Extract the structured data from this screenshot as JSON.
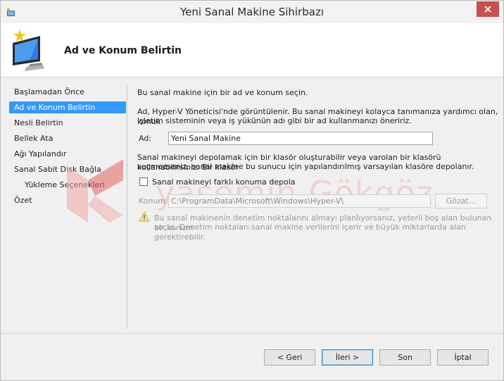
{
  "window": {
    "title": "Yeni Sanal Makine Sihirbazı"
  },
  "header": {
    "page_title": "Ad ve Konum Belirtin"
  },
  "nav": {
    "items": [
      {
        "label": "Başlamadan Önce",
        "active": false,
        "sub": false
      },
      {
        "label": "Ad ve Konum Belirtin",
        "active": true,
        "sub": false
      },
      {
        "label": "Nesli Belirtin",
        "active": false,
        "sub": false
      },
      {
        "label": "Bellek Ata",
        "active": false,
        "sub": false
      },
      {
        "label": "Ağı Yapılandır",
        "active": false,
        "sub": false
      },
      {
        "label": "Sanal Sabit Disk Bağla",
        "active": false,
        "sub": false
      },
      {
        "label": "Yükleme Seçenekleri",
        "active": false,
        "sub": true
      },
      {
        "label": "Özet",
        "active": false,
        "sub": false
      }
    ]
  },
  "content": {
    "intro": "Bu sanal makine için bir ad ve konum seçin.",
    "desc_line1": "Ad, Hyper-V Yöneticisi'nde görüntülenir. Bu sanal makineyi kolayca tanımanıza yardımcı olan, konuk",
    "desc_line2": "işletim sisteminin veya iş yükünün adı gibi bir ad kullanmanızı öneririz.",
    "name_label": "Ad:",
    "name_value": "Yeni Sanal Makine",
    "store_line1": "Sanal makineyi depolamak için bir klasör oluşturabilir veya varolan bir klasörü kullanabilirsiniz. Bir klasör",
    "store_line2": "seçmezseniz, sanal makine bu sunucu için yapılandırılmış varsayılan klasöre depolanır.",
    "checkbox_label": "Sanal makineyi farklı konuma depola",
    "location_label": "Konum:",
    "location_value": "C:\\ProgramData\\Microsoft\\Windows\\Hyper-V\\",
    "browse_label": "Gözat...",
    "warn_line1": "Bu sanal makinenin denetim noktalarını almayı planlıyorsanız, yeterli boş alan bulunan bir konum",
    "warn_line2": "seçin. Denetim noktaları sanal makine verilerini içerir ve büyük miktarlarda alan gerektirebilir."
  },
  "buttons": {
    "back": "< Geri",
    "next": "İleri >",
    "finish": "Son",
    "cancel": "İptal"
  },
  "watermark": {
    "text": "yasemin Gökgöz"
  },
  "colors": {
    "accent": "#3399ff",
    "close": "#c75050"
  }
}
